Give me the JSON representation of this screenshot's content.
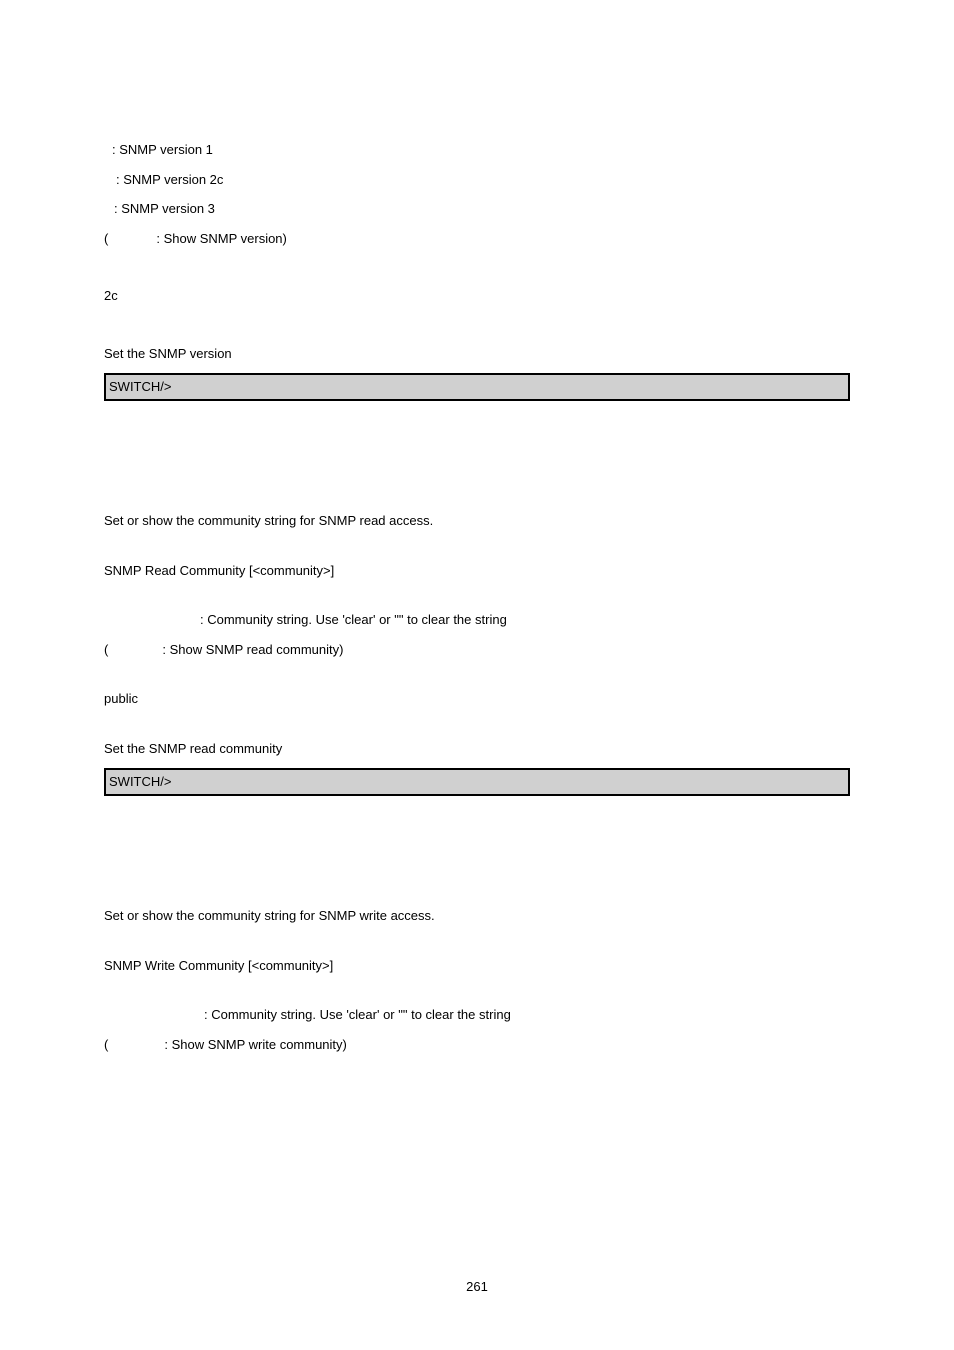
{
  "section1": {
    "line1": ": SNMP version 1",
    "line2": ": SNMP version 2c",
    "line3": ": SNMP version 3",
    "line4_open": "(",
    "line4_rest": ": Show SNMP version)",
    "default": "2c",
    "example_label": "Set the SNMP version",
    "code": "SWITCH/>"
  },
  "section2": {
    "desc": "Set or show the community string for SNMP read access.",
    "syntax": "SNMP Read Community [<community>]",
    "param_desc": ": Community string. Use 'clear' or \"\" to clear the string",
    "param_open": "(",
    "param_rest": ": Show SNMP read community)",
    "default": "public",
    "example_label": "Set the SNMP read community",
    "code": "SWITCH/>"
  },
  "section3": {
    "desc": "Set or show the community string for SNMP write access.",
    "syntax": "SNMP Write Community [<community>]",
    "param_desc": ": Community string. Use 'clear' or \"\" to clear the string",
    "param_open": "(",
    "param_rest": ": Show SNMP write community)"
  },
  "page_number": "261"
}
